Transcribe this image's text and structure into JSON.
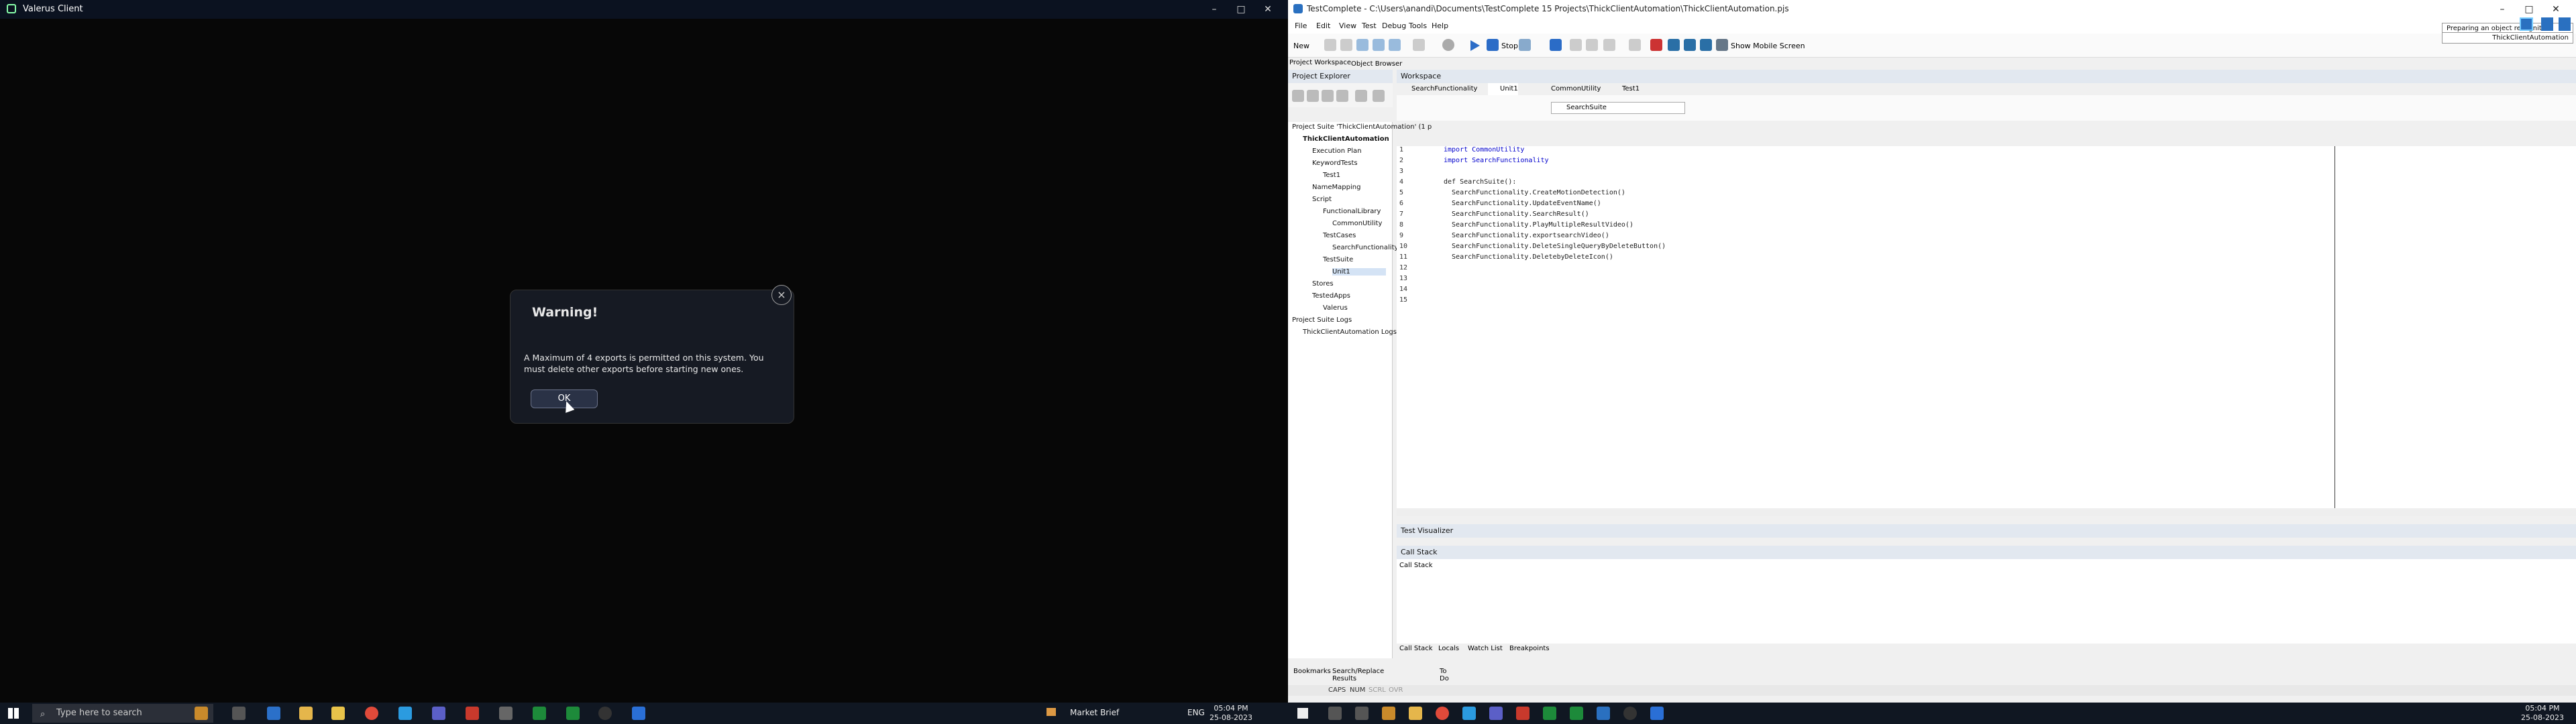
{
  "left_app": {
    "title": "Valerus Client",
    "dialog": {
      "title": "Warning!",
      "message": "A Maximum of 4 exports is permitted on this system. You must delete other exports before starting new ones.",
      "ok": "OK",
      "close": "×"
    }
  },
  "taskbar_left": {
    "search_placeholder": "Type here to search",
    "weather": "Market Brief",
    "lang": "ENG",
    "time": "05:04 PM",
    "date": "25-08-2023"
  },
  "testcomplete": {
    "title": "TestComplete - C:\\Users\\anandi\\Documents\\TestComplete 15 Projects\\ThickClientAutomation\\ThickClientAutomation.pjs",
    "menus": [
      "File",
      "Edit",
      "View",
      "Test",
      "Debug",
      "Tools",
      "Help"
    ],
    "toolbar": {
      "new": "New",
      "stop": "Stop",
      "show_mobile": "Show Mobile Screen"
    },
    "tooltip": {
      "line1": "Preparing an object recognition hint.",
      "line2": "ThickClientAutomation"
    },
    "tabs_left": {
      "project_workspace": "Project Workspace",
      "object_browser": "Object Browser"
    },
    "project_explorer": {
      "title": "Project Explorer",
      "items": [
        "Project Suite 'ThickClientAutomation' (1 p",
        "ThickClientAutomation",
        "Execution Plan",
        "KeywordTests",
        "Test1",
        "NameMapping",
        "Script",
        "FunctionalLibrary",
        "CommonUtility",
        "TestCases",
        "SearchFunctionality",
        "TestSuite",
        "Unit1",
        "Stores",
        "TestedApps",
        "Valerus",
        "Project Suite Logs",
        "ThickClientAutomation Logs"
      ]
    },
    "workspace": {
      "title": "Workspace",
      "tabs": [
        "SearchFunctionality",
        "Unit1",
        "CommonUtility",
        "Test1"
      ],
      "routine": "SearchSuite",
      "lines": [
        "import CommonUtility",
        "import SearchFunctionality",
        "",
        "def SearchSuite():",
        "  SearchFunctionality.CreateMotionDetection()",
        "  SearchFunctionality.UpdateEventName()",
        "  SearchFunctionality.SearchResult()",
        "  SearchFunctionality.PlayMultipleResultVideo()",
        "  SearchFunctionality.exportsearchVideo()",
        "  SearchFunctionality.DeleteSingleQueryByDeleteButton()",
        "  SearchFunctionality.DeletebyDeleteIcon()",
        "",
        "",
        "",
        ""
      ],
      "line_numbers": [
        "1",
        "2",
        "3",
        "4",
        "5",
        "6",
        "7",
        "8",
        "9",
        "10",
        "11",
        "12",
        "13",
        "14",
        "15"
      ]
    },
    "test_visualizer": "Test Visualizer",
    "call_stack": {
      "title": "Call Stack",
      "header": "Call Stack"
    },
    "bottom_tabs": [
      "Call Stack",
      "Locals",
      "Watch List",
      "Breakpoints"
    ],
    "left_bottom_tabs": [
      "Bookmarks",
      "Search/Replace Results",
      "To Do"
    ],
    "status": [
      "CAPS",
      "NUM",
      "SCRL",
      "OVR"
    ]
  },
  "taskbar_right": {
    "time": "05:04 PM",
    "date": "25-08-2023"
  }
}
